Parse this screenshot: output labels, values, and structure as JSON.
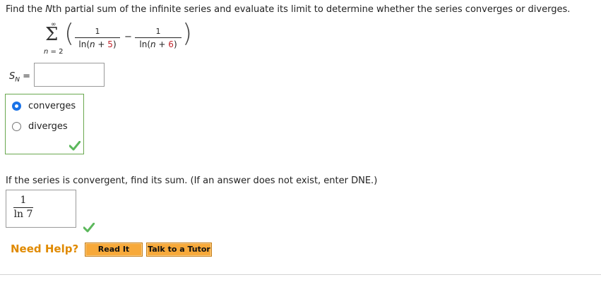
{
  "prompt": {
    "part1": "Find the ",
    "var": "N",
    "part2": "th partial sum of the infinite series and evaluate its limit to determine whether the series converges or diverges."
  },
  "series": {
    "upper": "∞",
    "sigma": "Σ",
    "lower_var": "n",
    "lower_rest": " = 2",
    "frac1": {
      "num": "1",
      "den_pre": "ln(",
      "den_var": "n",
      "den_op": " + ",
      "den_const": "5",
      "den_post": ")"
    },
    "minus": "−",
    "frac2": {
      "num": "1",
      "den_pre": "ln(",
      "den_var": "n",
      "den_op": " + ",
      "den_const": "6",
      "den_post": ")"
    },
    "open_paren": "(",
    "close_paren": ")"
  },
  "sn": {
    "label": "S",
    "sub": "N",
    "equals": " =",
    "value": ""
  },
  "radio": {
    "options": [
      {
        "label": "converges",
        "checked": true
      },
      {
        "label": "diverges",
        "checked": false
      }
    ]
  },
  "question2": "If the series is convergent, find its sum. (If an answer does not exist, enter DNE.)",
  "answer": {
    "num": "1",
    "den": "ln 7"
  },
  "help": {
    "label": "Need Help?",
    "read_it": "Read It",
    "tutor": "Talk to a Tutor"
  },
  "colors": {
    "check_green": "#5cb85c",
    "box_green": "#6aa84f",
    "help_orange": "#e08a00",
    "button_orange": "#f7a93a",
    "radio_blue": "#1a73e8",
    "const_red": "#c0262d"
  }
}
